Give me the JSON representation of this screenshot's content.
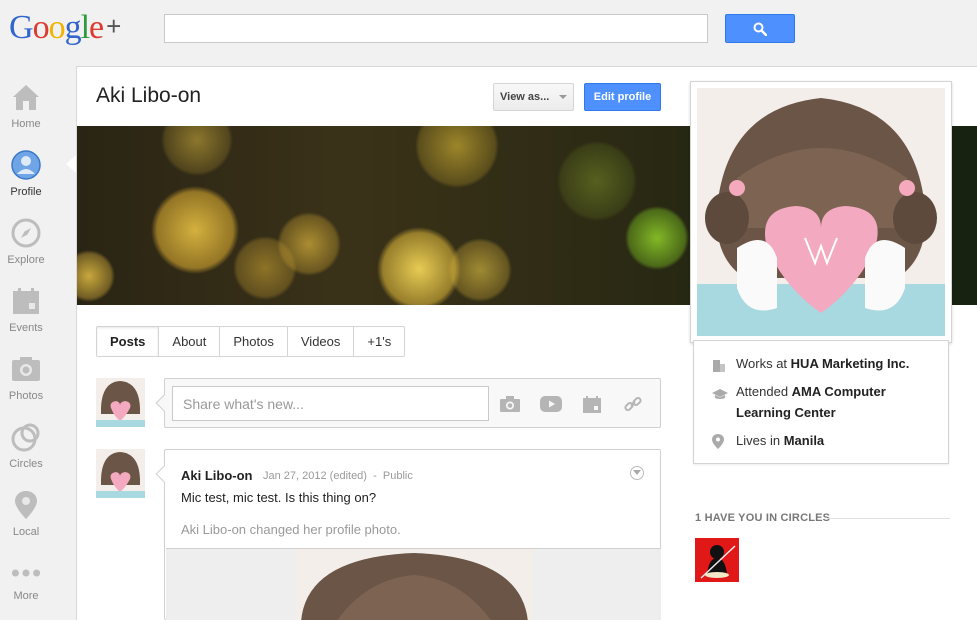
{
  "logo": {
    "text_google": "Google",
    "text_plus": "+"
  },
  "search": {
    "placeholder": "",
    "value": ""
  },
  "nav": {
    "items": [
      {
        "label": "Home",
        "icon": "home-icon"
      },
      {
        "label": "Profile",
        "icon": "profile-icon",
        "active": true
      },
      {
        "label": "Explore",
        "icon": "compass-icon"
      },
      {
        "label": "Events",
        "icon": "calendar-icon"
      },
      {
        "label": "Photos",
        "icon": "camera-icon"
      },
      {
        "label": "Circles",
        "icon": "circles-icon"
      },
      {
        "label": "Local",
        "icon": "pin-icon"
      },
      {
        "label": "More",
        "icon": "more-icon"
      }
    ]
  },
  "profile": {
    "name": "Aki Libo-on",
    "view_as_label": "View as...",
    "edit_profile_label": "Edit profile"
  },
  "tabs": [
    "Posts",
    "About",
    "Photos",
    "Videos",
    "+1's"
  ],
  "share": {
    "placeholder": "Share what's new..."
  },
  "post": {
    "author": "Aki Libo-on",
    "date": "Jan 27, 2012 (edited)",
    "separator": "-",
    "visibility": "Public",
    "text": "Mic test, mic test. Is this thing on?",
    "activity": "Aki Libo-on changed her profile photo."
  },
  "about": {
    "works_prefix": "Works at ",
    "works_value": "HUA Marketing Inc.",
    "attended_prefix": "Attended ",
    "attended_value": "AMA Computer Learning Center",
    "lives_prefix": "Lives in ",
    "lives_value": "Manila"
  },
  "circles": {
    "heading": "1 HAVE YOU IN CIRCLES"
  },
  "colors": {
    "accent_blue": "#4d90fe",
    "cover_dark": "#2a2414",
    "circle_avatar_bg": "#e01818"
  }
}
